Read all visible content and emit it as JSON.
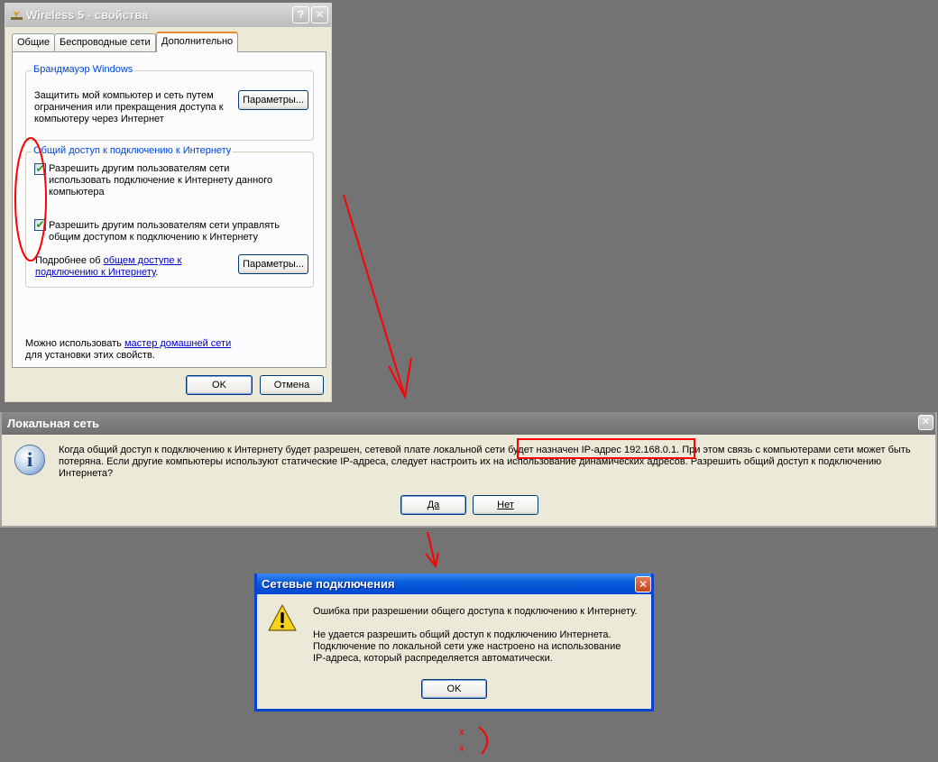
{
  "properties_window": {
    "title": "Wireless 5 - свойства",
    "help_button": "?",
    "close_button": "✕",
    "tabs": [
      {
        "label": "Общие"
      },
      {
        "label": "Беспроводные сети"
      },
      {
        "label": "Дополнительно"
      }
    ],
    "firewall_group": {
      "legend": "Брандмауэр Windows",
      "text_lines": [
        "Защитить мой компьютер и сеть путем",
        "ограничения или прекращения доступа к",
        "компьютеру через Интернет"
      ],
      "button": "Параметры..."
    },
    "sharing_group": {
      "legend": "Общий доступ к подключению к Интернету",
      "checkbox1": {
        "checked": true,
        "lines": [
          "Разрешить другим пользователям сети",
          "использовать подключение к Интернету данного",
          "компьютера"
        ]
      },
      "checkbox2": {
        "checked": true,
        "lines": [
          "Разрешить другим пользователям сети управлять",
          "общим доступом к подключению к Интернету"
        ]
      },
      "more_prefix": "Подробнее об ",
      "more_link_line1": "общем доступе к",
      "more_link_line2": "подключению к Интернету",
      "more_suffix": ".",
      "button": "Параметры..."
    },
    "wizard_prefix": "Можно использовать ",
    "wizard_link": "мастер домашней сети",
    "wizard_suffix": "для установки этих свойств.",
    "ok_button": "OK",
    "cancel_button": "Отмена"
  },
  "local_network_dialog": {
    "title": "Локальная сеть",
    "close_button": "✕",
    "message_line1_a": "Когда общий доступ к подключению к Интернету будет разрешен, сетевой плате локальной сети ",
    "message_line1_b": "будет назначен IP-адрес 192.168.0.1.",
    "message_line1_c": " При этом связь с компьютерами сети может быть",
    "message_line2": "потеряна. Если другие компьютеры используют статические IP-адреса, следует настроить их на использование динамических адресов. Разрешить общий доступ к подключению",
    "message_line3": "Интернета?",
    "yes_button": "Да",
    "no_button": "Нет"
  },
  "network_connections_dialog": {
    "title": "Сетевые подключения",
    "close_button": "✕",
    "message_line1": "Ошибка при разрешении общего доступа к подключению к Интернету.",
    "message_line2": "Не удается разрешить общий доступ к подключению Интернета.",
    "message_line3": "Подключение по локальной сети уже настроено на использование",
    "message_line4": " IP-адреса, который распределяется автоматически.",
    "ok_button": "OK"
  },
  "annotation_marks": {
    "mark1": "x",
    "mark2": "x",
    "color": "#ff0000"
  },
  "colors": {
    "desktop": "#737373",
    "dialog_bg": "#ece9d8",
    "xp_blue": "#0046d5",
    "annotation_red": "#ff0000"
  }
}
